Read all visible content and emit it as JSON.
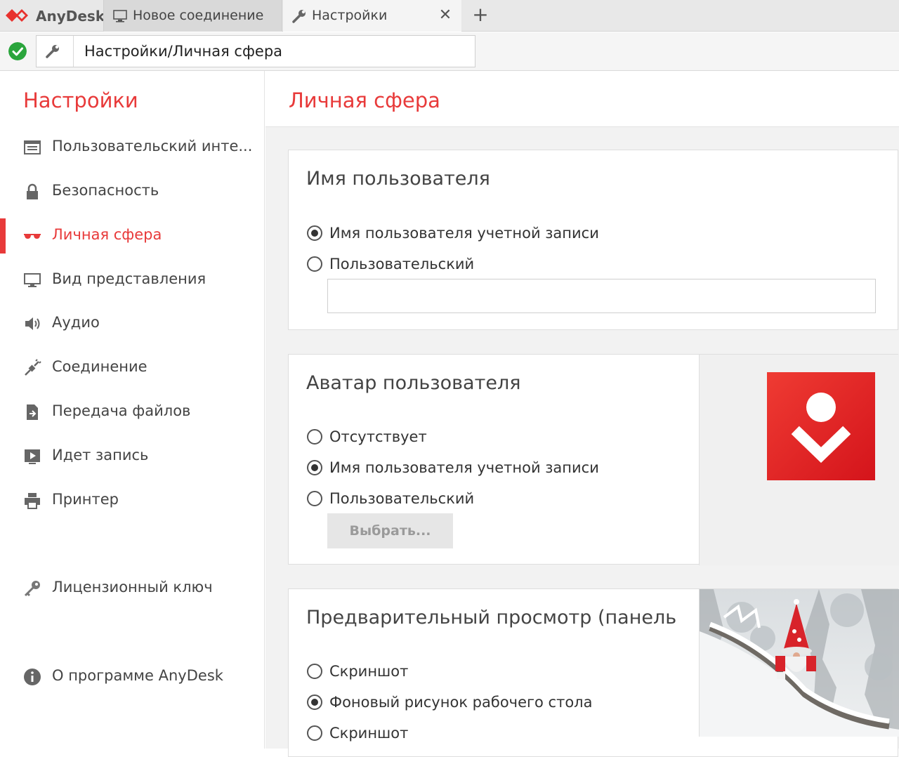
{
  "app": {
    "name": "AnyDesk",
    "accent": "#e83a3a",
    "ok_color": "#2aa53c"
  },
  "tabs": [
    {
      "label": "Новое соединение",
      "icon": "monitor-icon"
    },
    {
      "label": "Настройки",
      "icon": "wrench-icon",
      "close": "✕"
    }
  ],
  "tab_add": "+",
  "address": {
    "status_icon": "check-circle-icon",
    "icon": "wrench-icon",
    "value": "Настройки/Личная сфера"
  },
  "sidebar": {
    "title": "Настройки",
    "items": [
      {
        "label": "Пользовательский инте...",
        "icon": "interface-icon"
      },
      {
        "label": "Безопасность",
        "icon": "lock-icon"
      },
      {
        "label": "Личная сфера",
        "icon": "glasses-icon",
        "active": true
      },
      {
        "label": "Вид представления",
        "icon": "monitor-icon"
      },
      {
        "label": "Аудио",
        "icon": "speaker-icon"
      },
      {
        "label": "Соединение",
        "icon": "plug-icon"
      },
      {
        "label": "Передача файлов",
        "icon": "file-icon"
      },
      {
        "label": "Идет запись",
        "icon": "play-icon"
      },
      {
        "label": "Принтер",
        "icon": "printer-icon"
      },
      {
        "label": "Лицензионный ключ",
        "icon": "key-icon"
      },
      {
        "label": "О программе AnyDesk",
        "icon": "info-icon"
      }
    ]
  },
  "main": {
    "title": "Личная сфера",
    "username": {
      "title": "Имя пользователя",
      "options": [
        {
          "label": "Имя пользователя учетной записи",
          "checked": true
        },
        {
          "label": "Пользовательский",
          "checked": false
        }
      ],
      "custom_value": ""
    },
    "avatar": {
      "title": "Аватар пользователя",
      "options": [
        {
          "label": "Отсутствует",
          "checked": false
        },
        {
          "label": "Имя пользователя учетной записи",
          "checked": true
        },
        {
          "label": "Пользовательский",
          "checked": false
        }
      ],
      "choose_button": "Выбрать..."
    },
    "preview": {
      "title": "Предварительный просмотр (панель",
      "options": [
        {
          "label": "Скриншот",
          "checked": false
        },
        {
          "label": "Фоновый рисунок рабочего стола",
          "checked": true
        },
        {
          "label": "Скриншот",
          "checked": false
        }
      ]
    }
  }
}
